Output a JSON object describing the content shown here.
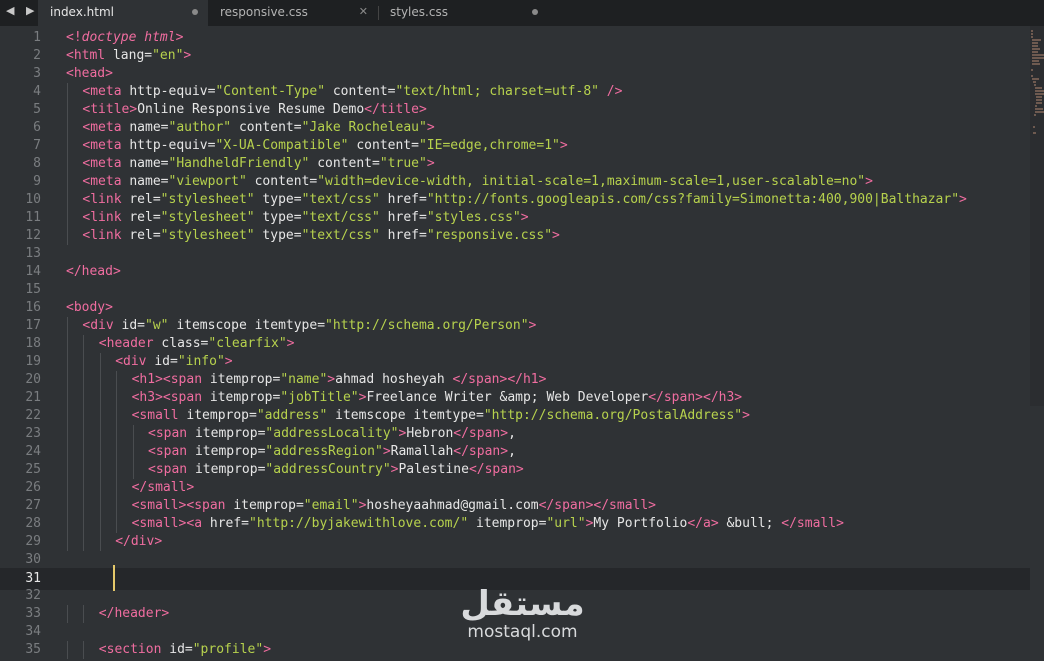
{
  "tabs": [
    {
      "label": "index.html",
      "state": "modified"
    },
    {
      "label": "responsive.css",
      "state": "close"
    },
    {
      "label": "styles.css",
      "state": "modified"
    }
  ],
  "tab_icons": {
    "nav_arrows": "◀ ▶",
    "close": "✕"
  },
  "lines": [
    {
      "n": 1,
      "indent": 0,
      "tokens": [
        [
          "tag",
          "<!"
        ],
        [
          "kw",
          "doctype html"
        ],
        [
          "tag",
          ">"
        ]
      ]
    },
    {
      "n": 2,
      "indent": 0,
      "tokens": [
        [
          "tag",
          "<html"
        ],
        [
          "attr",
          " lang="
        ],
        [
          "str",
          "\"en\""
        ],
        [
          "tag",
          ">"
        ]
      ]
    },
    {
      "n": 3,
      "indent": 0,
      "tokens": [
        [
          "tag",
          "<head>"
        ]
      ]
    },
    {
      "n": 4,
      "indent": 1,
      "tokens": [
        [
          "tag",
          "<meta"
        ],
        [
          "attr",
          " http-equiv="
        ],
        [
          "str",
          "\"Content-Type\""
        ],
        [
          "attr",
          " content="
        ],
        [
          "str",
          "\"text/html; charset=utf-8\""
        ],
        [
          "tag",
          " />"
        ]
      ]
    },
    {
      "n": 5,
      "indent": 1,
      "tokens": [
        [
          "tag",
          "<title>"
        ],
        [
          "txt",
          "Online Responsive Resume Demo"
        ],
        [
          "tag",
          "</title>"
        ]
      ]
    },
    {
      "n": 6,
      "indent": 1,
      "tokens": [
        [
          "tag",
          "<meta"
        ],
        [
          "attr",
          " name="
        ],
        [
          "str",
          "\"author\""
        ],
        [
          "attr",
          " content="
        ],
        [
          "str",
          "\"Jake Rocheleau\""
        ],
        [
          "tag",
          ">"
        ]
      ]
    },
    {
      "n": 7,
      "indent": 1,
      "tokens": [
        [
          "tag",
          "<meta"
        ],
        [
          "attr",
          " http-equiv="
        ],
        [
          "str",
          "\"X-UA-Compatible\""
        ],
        [
          "attr",
          " content="
        ],
        [
          "str",
          "\"IE=edge,chrome=1\""
        ],
        [
          "tag",
          ">"
        ]
      ]
    },
    {
      "n": 8,
      "indent": 1,
      "tokens": [
        [
          "tag",
          "<meta"
        ],
        [
          "attr",
          " name="
        ],
        [
          "str",
          "\"HandheldFriendly\""
        ],
        [
          "attr",
          " content="
        ],
        [
          "str",
          "\"true\""
        ],
        [
          "tag",
          ">"
        ]
      ]
    },
    {
      "n": 9,
      "indent": 1,
      "tokens": [
        [
          "tag",
          "<meta"
        ],
        [
          "attr",
          " name="
        ],
        [
          "str",
          "\"viewport\""
        ],
        [
          "attr",
          " content="
        ],
        [
          "str",
          "\"width=device-width, initial-scale=1,maximum-scale=1,user-scalable=no\""
        ],
        [
          "tag",
          ">"
        ]
      ]
    },
    {
      "n": 10,
      "indent": 1,
      "tokens": [
        [
          "tag",
          "<link"
        ],
        [
          "attr",
          " rel="
        ],
        [
          "str",
          "\"stylesheet\""
        ],
        [
          "attr",
          " type="
        ],
        [
          "str",
          "\"text/css\""
        ],
        [
          "attr",
          " href="
        ],
        [
          "str",
          "\"http://fonts.googleapis.com/css?family=Simonetta:400,900|Balthazar\""
        ],
        [
          "tag",
          ">"
        ]
      ]
    },
    {
      "n": 11,
      "indent": 1,
      "tokens": [
        [
          "tag",
          "<link"
        ],
        [
          "attr",
          " rel="
        ],
        [
          "str",
          "\"stylesheet\""
        ],
        [
          "attr",
          " type="
        ],
        [
          "str",
          "\"text/css\""
        ],
        [
          "attr",
          " href="
        ],
        [
          "str",
          "\"styles.css\""
        ],
        [
          "tag",
          ">"
        ]
      ]
    },
    {
      "n": 12,
      "indent": 1,
      "tokens": [
        [
          "tag",
          "<link"
        ],
        [
          "attr",
          " rel="
        ],
        [
          "str",
          "\"stylesheet\""
        ],
        [
          "attr",
          " type="
        ],
        [
          "str",
          "\"text/css\""
        ],
        [
          "attr",
          " href="
        ],
        [
          "str",
          "\"responsive.css\""
        ],
        [
          "tag",
          ">"
        ]
      ]
    },
    {
      "n": 13,
      "indent": 0,
      "tokens": []
    },
    {
      "n": 14,
      "indent": 0,
      "tokens": [
        [
          "tag",
          "</head>"
        ]
      ]
    },
    {
      "n": 15,
      "indent": 0,
      "tokens": []
    },
    {
      "n": 16,
      "indent": 0,
      "tokens": [
        [
          "tag",
          "<body>"
        ]
      ]
    },
    {
      "n": 17,
      "indent": 1,
      "tokens": [
        [
          "tag",
          "<div"
        ],
        [
          "attr",
          " id="
        ],
        [
          "str",
          "\"w\""
        ],
        [
          "attr",
          " itemscope itemtype="
        ],
        [
          "str",
          "\"http://schema.org/Person\""
        ],
        [
          "tag",
          ">"
        ]
      ]
    },
    {
      "n": 18,
      "indent": 2,
      "tokens": [
        [
          "tag",
          "<header"
        ],
        [
          "attr",
          " class="
        ],
        [
          "str",
          "\"clearfix\""
        ],
        [
          "tag",
          ">"
        ]
      ]
    },
    {
      "n": 19,
      "indent": 3,
      "tokens": [
        [
          "tag",
          "<div"
        ],
        [
          "attr",
          " id="
        ],
        [
          "str",
          "\"info\""
        ],
        [
          "tag",
          ">"
        ]
      ]
    },
    {
      "n": 20,
      "indent": 4,
      "tokens": [
        [
          "tag",
          "<h1><span"
        ],
        [
          "attr",
          " itemprop="
        ],
        [
          "str",
          "\"name\""
        ],
        [
          "tag",
          ">"
        ],
        [
          "txt",
          "ahmad hosheyah "
        ],
        [
          "tag",
          "</span></h1>"
        ]
      ]
    },
    {
      "n": 21,
      "indent": 4,
      "tokens": [
        [
          "tag",
          "<h3><span"
        ],
        [
          "attr",
          " itemprop="
        ],
        [
          "str",
          "\"jobTitle\""
        ],
        [
          "tag",
          ">"
        ],
        [
          "txt",
          "Freelance Writer &amp; Web Developer"
        ],
        [
          "tag",
          "</span></h3>"
        ]
      ]
    },
    {
      "n": 22,
      "indent": 4,
      "tokens": [
        [
          "tag",
          "<small"
        ],
        [
          "attr",
          " itemprop="
        ],
        [
          "str",
          "\"address\""
        ],
        [
          "attr",
          " itemscope itemtype="
        ],
        [
          "str",
          "\"http://schema.org/PostalAddress\""
        ],
        [
          "tag",
          ">"
        ]
      ]
    },
    {
      "n": 23,
      "indent": 5,
      "tokens": [
        [
          "tag",
          "<span"
        ],
        [
          "attr",
          " itemprop="
        ],
        [
          "str",
          "\"addressLocality\""
        ],
        [
          "tag",
          ">"
        ],
        [
          "txt",
          "Hebron"
        ],
        [
          "tag",
          "</span>"
        ],
        [
          "txt",
          ","
        ]
      ]
    },
    {
      "n": 24,
      "indent": 5,
      "tokens": [
        [
          "tag",
          "<span"
        ],
        [
          "attr",
          " itemprop="
        ],
        [
          "str",
          "\"addressRegion\""
        ],
        [
          "tag",
          ">"
        ],
        [
          "txt",
          "Ramallah"
        ],
        [
          "tag",
          "</span>"
        ],
        [
          "txt",
          ","
        ]
      ]
    },
    {
      "n": 25,
      "indent": 5,
      "tokens": [
        [
          "tag",
          "<span"
        ],
        [
          "attr",
          " itemprop="
        ],
        [
          "str",
          "\"addressCountry\""
        ],
        [
          "tag",
          ">"
        ],
        [
          "txt",
          "Palestine"
        ],
        [
          "tag",
          "</span>"
        ]
      ]
    },
    {
      "n": 26,
      "indent": 4,
      "tokens": [
        [
          "tag",
          "</small>"
        ]
      ]
    },
    {
      "n": 27,
      "indent": 4,
      "tokens": [
        [
          "tag",
          "<small><span"
        ],
        [
          "attr",
          " itemprop="
        ],
        [
          "str",
          "\"email\""
        ],
        [
          "tag",
          ">"
        ],
        [
          "txt",
          "hosheyaahmad@gmail.com"
        ],
        [
          "tag",
          "</span></small>"
        ]
      ]
    },
    {
      "n": 28,
      "indent": 4,
      "tokens": [
        [
          "tag",
          "<small><a"
        ],
        [
          "attr",
          " href="
        ],
        [
          "str",
          "\"http://byjakewithlove.com/\""
        ],
        [
          "attr",
          " itemprop="
        ],
        [
          "str",
          "\"url\""
        ],
        [
          "tag",
          ">"
        ],
        [
          "txt",
          "My Portfolio"
        ],
        [
          "tag",
          "</a>"
        ],
        [
          "txt",
          " &bull; "
        ],
        [
          "tag",
          "</small>"
        ]
      ]
    },
    {
      "n": 29,
      "indent": 3,
      "tokens": [
        [
          "tag",
          "</div>"
        ]
      ]
    },
    {
      "n": 30,
      "indent": 0,
      "tokens": []
    },
    {
      "n": 31,
      "indent": 0,
      "tokens": [],
      "current": true
    },
    {
      "n": 32,
      "indent": 0,
      "tokens": []
    },
    {
      "n": 33,
      "indent": 2,
      "tokens": [
        [
          "tag",
          "</header>"
        ]
      ]
    },
    {
      "n": 34,
      "indent": 0,
      "tokens": []
    },
    {
      "n": 35,
      "indent": 2,
      "tokens": [
        [
          "tag",
          "<section"
        ],
        [
          "attr",
          " id="
        ],
        [
          "str",
          "\"profile\""
        ],
        [
          "tag",
          ">"
        ]
      ]
    }
  ],
  "watermark": {
    "logo": "مستقل",
    "text": "mostaql.com"
  },
  "colors": {
    "tag": "#f06da0",
    "string": "#b7d24d",
    "text": "#e6e6e6",
    "cursor": "#e4c86a",
    "background": "#2f3235"
  }
}
